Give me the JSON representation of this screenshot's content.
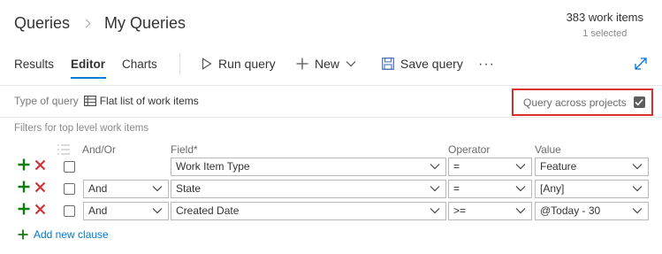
{
  "breadcrumb": {
    "root": "Queries",
    "current": "My Queries"
  },
  "summary": {
    "count": "383 work items",
    "selected": "1 selected"
  },
  "tabs": [
    {
      "label": "Results",
      "active": false
    },
    {
      "label": "Editor",
      "active": true
    },
    {
      "label": "Charts",
      "active": false
    }
  ],
  "commands": {
    "run": "Run query",
    "new": "New",
    "save": "Save query"
  },
  "query_type": {
    "label": "Type of query",
    "value": "Flat list of work items"
  },
  "across_projects": {
    "label": "Query across projects",
    "checked": true
  },
  "filters": {
    "title": "Filters for top level work items",
    "headers": {
      "andor": "And/Or",
      "field": "Field*",
      "operator": "Operator",
      "value": "Value"
    },
    "rows": [
      {
        "andor": "",
        "field": "Work Item Type",
        "operator": "=",
        "value": "Feature"
      },
      {
        "andor": "And",
        "field": "State",
        "operator": "=",
        "value": "[Any]"
      },
      {
        "andor": "And",
        "field": "Created Date",
        "operator": ">=",
        "value": "@Today - 30"
      }
    ],
    "add_clause": "Add new clause"
  },
  "colors": {
    "accent": "#0078d4",
    "add_green": "#107c10",
    "delete_red": "#d13438",
    "highlight_red": "#d9302c"
  }
}
